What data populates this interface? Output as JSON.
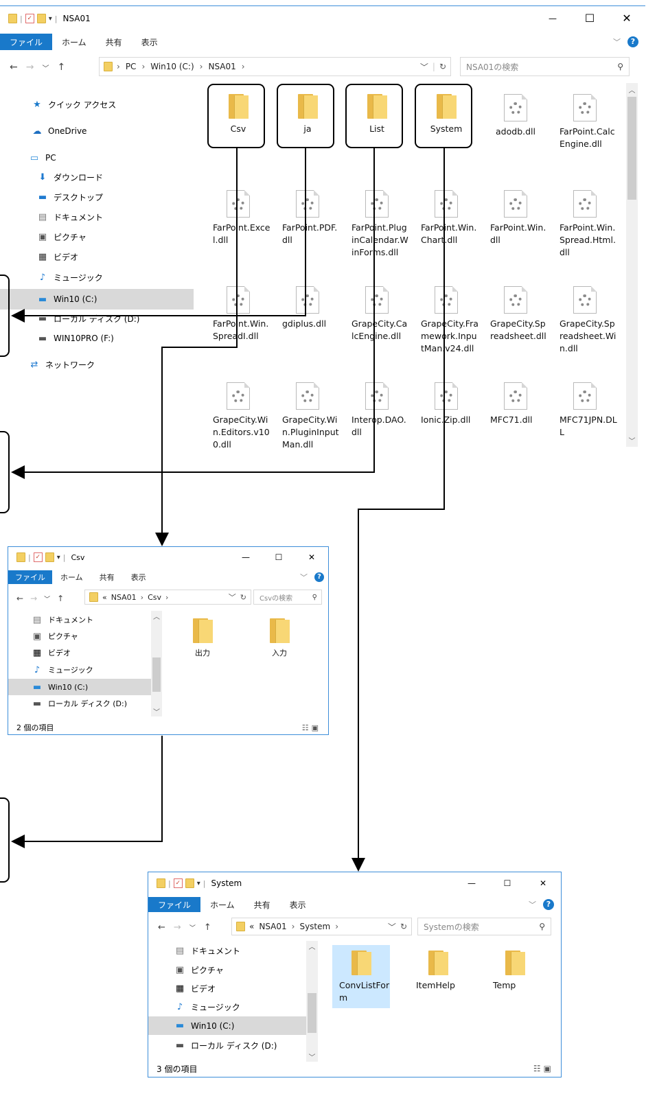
{
  "main": {
    "title": "NSA01",
    "ribbon": {
      "file": "ファイル",
      "home": "ホーム",
      "share": "共有",
      "view": "表示"
    },
    "window_controls": {
      "min": "—",
      "max": "☐",
      "close": "✕"
    },
    "address": {
      "crumbs": [
        "PC",
        "Win10 (C:)",
        "NSA01"
      ]
    },
    "search_placeholder": "NSA01の検索",
    "nav": [
      {
        "label": "クイック アクセス",
        "icon": "star-icon"
      },
      {
        "label": "OneDrive",
        "icon": "cloud-icon"
      },
      {
        "label": "PC",
        "icon": "computer-icon"
      },
      {
        "label": "ダウンロード",
        "icon": "download-icon"
      },
      {
        "label": "デスクトップ",
        "icon": "desktop-icon"
      },
      {
        "label": "ドキュメント",
        "icon": "document-icon"
      },
      {
        "label": "ピクチャ",
        "icon": "picture-icon"
      },
      {
        "label": "ビデオ",
        "icon": "video-icon"
      },
      {
        "label": "ミュージック",
        "icon": "music-icon"
      },
      {
        "label": "Win10 (C:)",
        "icon": "drive-icon",
        "selected": true
      },
      {
        "label": "ローカル ディスク (D:)",
        "icon": "disk-icon"
      },
      {
        "label": "WIN10PRO (F:)",
        "icon": "disk-icon"
      },
      {
        "label": "ネットワーク",
        "icon": "network-icon"
      }
    ],
    "files": [
      {
        "name": "Csv",
        "type": "folder"
      },
      {
        "name": "ja",
        "type": "folder"
      },
      {
        "name": "List",
        "type": "folder"
      },
      {
        "name": "System",
        "type": "folder"
      },
      {
        "name": "adodb.dll",
        "type": "dll"
      },
      {
        "name": "FarPoint.CalcEngine.dll",
        "type": "dll"
      },
      {
        "name": "FarPoint.Excel.dll",
        "type": "dll"
      },
      {
        "name": "FarPoint.PDF.dll",
        "type": "dll"
      },
      {
        "name": "FarPoint.PluginCalendar.WinForms.dll",
        "type": "dll"
      },
      {
        "name": "FarPoint.Win.Chart.dll",
        "type": "dll"
      },
      {
        "name": "FarPoint.Win.dll",
        "type": "dll"
      },
      {
        "name": "FarPoint.Win.Spread.Html.dll",
        "type": "dll"
      },
      {
        "name": "FarPoint.Win.SpreadI.dll",
        "type": "dll"
      },
      {
        "name": "gdiplus.dll",
        "type": "dll"
      },
      {
        "name": "GrapeCity.CalcEngine.dll",
        "type": "dll"
      },
      {
        "name": "GrapeCity.Framework.InputMan.v24.dll",
        "type": "dll"
      },
      {
        "name": "GrapeCity.Spreadsheet.dll",
        "type": "dll"
      },
      {
        "name": "GrapeCity.Spreadsheet.Win.dll",
        "type": "dll"
      },
      {
        "name": "GrapeCity.Win.Editors.v100.dll",
        "type": "dll"
      },
      {
        "name": "GrapeCity.Win.PluginInputMan.dll",
        "type": "dll"
      },
      {
        "name": "Interop.DAO.dll",
        "type": "dll"
      },
      {
        "name": "Ionic.Zip.dll",
        "type": "dll"
      },
      {
        "name": "MFC71.dll",
        "type": "dll"
      },
      {
        "name": "MFC71JPN.DLL",
        "type": "dll"
      }
    ]
  },
  "csv": {
    "title": "Csv",
    "ribbon": {
      "file": "ファイル",
      "home": "ホーム",
      "share": "共有",
      "view": "表示"
    },
    "window_controls": {
      "min": "—",
      "max": "☐",
      "close": "✕"
    },
    "address": {
      "crumbs": [
        "«",
        "NSA01",
        "Csv"
      ]
    },
    "search_placeholder": "Csvの検索",
    "nav": [
      {
        "label": "ドキュメント",
        "icon": "document-icon"
      },
      {
        "label": "ピクチャ",
        "icon": "picture-icon"
      },
      {
        "label": "ビデオ",
        "icon": "video-icon"
      },
      {
        "label": "ミュージック",
        "icon": "music-icon"
      },
      {
        "label": "Win10 (C:)",
        "icon": "drive-icon",
        "selected": true
      },
      {
        "label": "ローカル ディスク (D:)",
        "icon": "disk-icon"
      }
    ],
    "files": [
      {
        "name": "出力",
        "type": "folder"
      },
      {
        "name": "入力",
        "type": "folder"
      }
    ],
    "status": "2 個の項目"
  },
  "system": {
    "title": "System",
    "ribbon": {
      "file": "ファイル",
      "home": "ホーム",
      "share": "共有",
      "view": "表示"
    },
    "window_controls": {
      "min": "—",
      "max": "☐",
      "close": "✕"
    },
    "address": {
      "crumbs": [
        "«",
        "NSA01",
        "System"
      ]
    },
    "search_placeholder": "Systemの検索",
    "nav": [
      {
        "label": "ドキュメント",
        "icon": "document-icon"
      },
      {
        "label": "ピクチャ",
        "icon": "picture-icon"
      },
      {
        "label": "ビデオ",
        "icon": "video-icon"
      },
      {
        "label": "ミュージック",
        "icon": "music-icon"
      },
      {
        "label": "Win10 (C:)",
        "icon": "drive-icon",
        "selected": true
      },
      {
        "label": "ローカル ディスク (D:)",
        "icon": "disk-icon"
      }
    ],
    "files": [
      {
        "name": "ConvListForm",
        "type": "folder",
        "selected": true
      },
      {
        "name": "ItemHelp",
        "type": "folder"
      },
      {
        "name": "Temp",
        "type": "folder"
      }
    ],
    "status": "3 個の項目"
  },
  "colors": {
    "accent": "#1979ca",
    "folder": "#f8d775",
    "selection": "#d9d9d9",
    "border": "#3c8dd9"
  }
}
